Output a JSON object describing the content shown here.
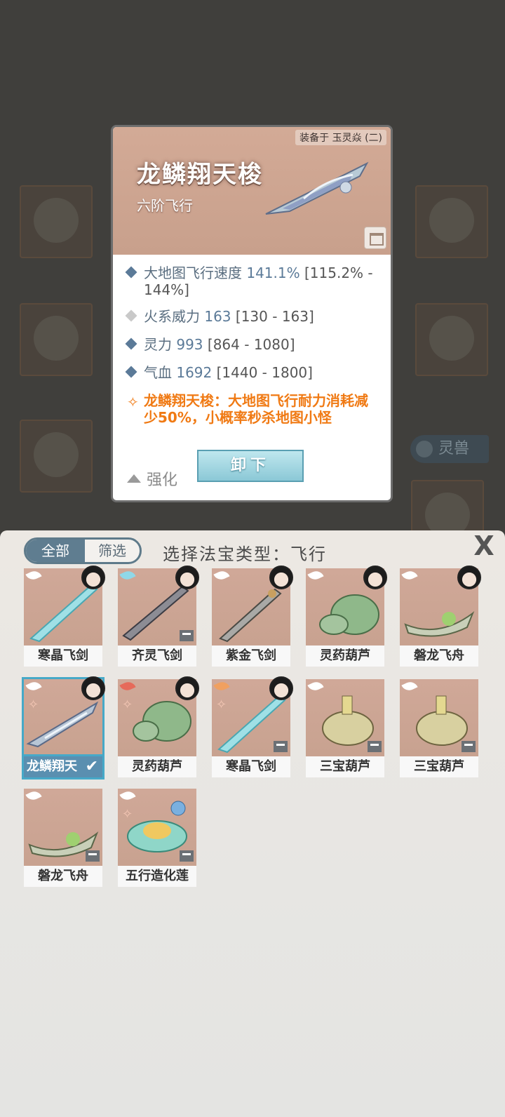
{
  "detail": {
    "equipped_on": "装备于 玉灵焱 (二)",
    "name": "龙鳞翔天梭",
    "tier": "六阶飞行",
    "attributes": [
      {
        "name": "大地图飞行速度",
        "value": "141.1%",
        "range": "[115.2% -",
        "range_cont": "144%]"
      },
      {
        "name": "火系威力",
        "value": "163",
        "range": "[130 - 163]"
      },
      {
        "name": "灵力",
        "value": "993",
        "range": "[864 - 1080]"
      },
      {
        "name": "气血",
        "value": "1692",
        "range": "[1440 - 1800]"
      }
    ],
    "special_line1": "龙鳞翔天梭：大地图飞行耐力消耗减",
    "special_line2": "少50%，小概率秒杀地图小怪",
    "strengthen_label": "强化",
    "unequip_label": "卸下"
  },
  "background": {
    "pet_tab": "灵兽"
  },
  "panel": {
    "tab_all": "全部",
    "tab_filter": "筛选",
    "title": "选择法宝类型：飞行",
    "close": "X",
    "items": [
      {
        "label": "寒晶飞剑"
      },
      {
        "label": "齐灵飞剑"
      },
      {
        "label": "紫金飞剑"
      },
      {
        "label": "灵药葫芦"
      },
      {
        "label": "磐龙飞舟"
      },
      {
        "label": "龙鳞翔天"
      },
      {
        "label": "灵药葫芦"
      },
      {
        "label": "寒晶飞剑"
      },
      {
        "label": "三宝葫芦"
      },
      {
        "label": "三宝葫芦"
      },
      {
        "label": "磐龙飞舟"
      },
      {
        "label": "五行造化莲"
      }
    ]
  },
  "colors": {
    "accent_blue": "#5b7a98",
    "special_orange": "#f07a14",
    "selected_border": "#46a9c8"
  }
}
